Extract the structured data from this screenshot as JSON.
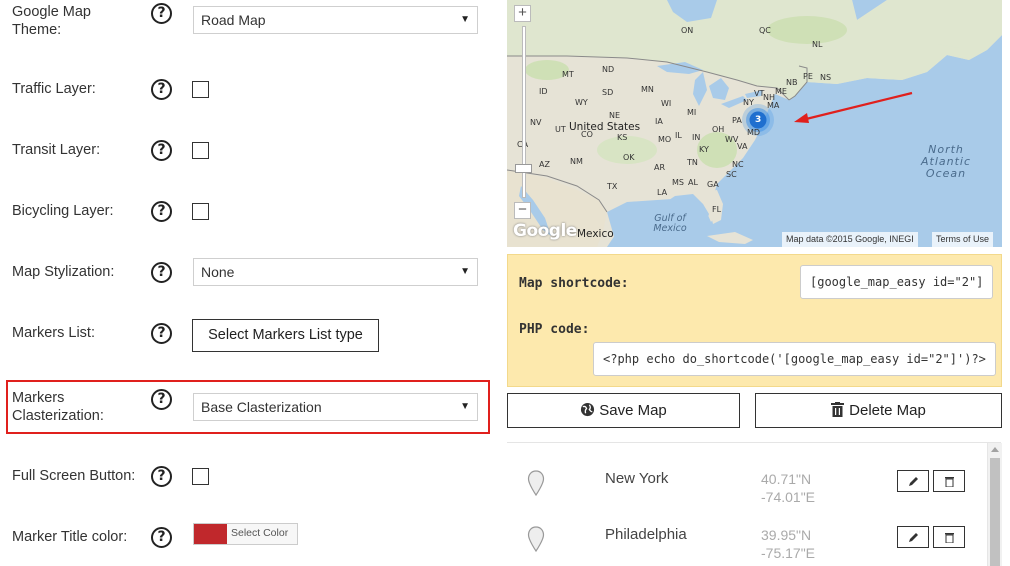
{
  "settings": {
    "theme": {
      "label": "Google Map Theme:",
      "value": "Road Map"
    },
    "traffic": {
      "label": "Traffic Layer:"
    },
    "transit": {
      "label": "Transit Layer:"
    },
    "bicycling": {
      "label": "Bicycling Layer:"
    },
    "stylization": {
      "label": "Map Stylization:",
      "value": "None"
    },
    "markers_list": {
      "label": "Markers List:",
      "button": "Select Markers List type"
    },
    "clusterization": {
      "label": "Markers Clasterization:",
      "value": "Base Clasterization"
    },
    "fullscreen": {
      "label": "Full Screen Button:"
    },
    "title_color": {
      "label": "Marker Title color:",
      "button": "Select Color",
      "color": "#c0282c"
    },
    "help_glyph": "?",
    "select_arrow": "▼"
  },
  "map": {
    "labels": {
      "on": "ON",
      "qc": "QC",
      "nl": "NL",
      "pe": "PE",
      "ns": "NS",
      "nb": "NB",
      "me": "ME",
      "vt": "VT",
      "nh": "NH",
      "ny": "NY",
      "ma": "MA",
      "pa": "PA",
      "oh": "OH",
      "in": "IN",
      "il": "IL",
      "mi": "MI",
      "wi": "WI",
      "mn": "MN",
      "ia": "IA",
      "nd": "ND",
      "sd": "SD",
      "ne": "NE",
      "ks": "KS",
      "mo": "MO",
      "ky": "KY",
      "wv": "WV",
      "va": "VA",
      "nc": "NC",
      "sc": "SC",
      "tn": "TN",
      "ar": "AR",
      "ms": "MS",
      "al": "AL",
      "ga": "GA",
      "fl": "FL",
      "la": "LA",
      "tx": "TX",
      "ok": "OK",
      "nm": "NM",
      "az": "AZ",
      "co": "CO",
      "ut": "UT",
      "nv": "NV",
      "wy": "WY",
      "mt": "MT",
      "id": "ID",
      "ca": "CA",
      "md": "MD",
      "us": "United States",
      "mexico": "Mexico",
      "gulf": "Gulf of Mexico",
      "ocean": "North Atlantic Ocean"
    },
    "cluster_count": "3",
    "zoom_in": "+",
    "zoom_out": "−",
    "google": "Google",
    "attribution": "Map data ©2015 Google, INEGI",
    "terms": "Terms of Use"
  },
  "shortcode": {
    "map_label": "Map shortcode:",
    "map_value": "[google_map_easy id=\"2\"]",
    "php_label": "PHP code:",
    "php_value": "<?php echo do_shortcode('[google_map_easy id=\"2\"]')?>"
  },
  "actions": {
    "save": "Save Map",
    "delete": "Delete Map"
  },
  "markers": [
    {
      "name": "New York",
      "lat": "40.71\"N",
      "lng": "-74.01\"E"
    },
    {
      "name": "Philadelphia",
      "lat": "39.95\"N",
      "lng": "-75.17\"E"
    }
  ]
}
